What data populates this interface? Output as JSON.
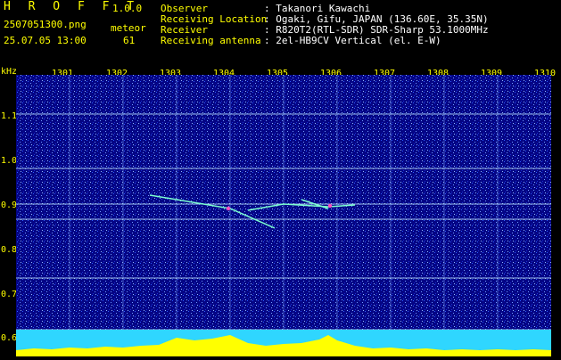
{
  "header": {
    "app_name": "H R O F F T",
    "version": "1.0.0",
    "filename": "2507051300.png",
    "datetime": "25.07.05 13:00",
    "meteor_label": "meteor",
    "meteor_count": "61",
    "fields": [
      {
        "label": "Observer",
        "value": ": Takanori Kawachi"
      },
      {
        "label": "Receiving Location",
        "value": ": Ogaki, Gifu, JAPAN (136.60E, 35.35N)"
      },
      {
        "label": "Receiver",
        "value": ": R820T2(RTL-SDR) SDR-Sharp 53.1000MHz"
      },
      {
        "label": "Receiving antenna",
        "value": ": 2el-HB9CV Vertical (el. E-W)"
      }
    ]
  },
  "axis": {
    "unit_label": "kHz",
    "x_ticks": [
      "1301",
      "1302",
      "1303",
      "1304",
      "1305",
      "1306",
      "1307",
      "1308",
      "1309",
      "1310"
    ],
    "y_ticks": [
      "1.1",
      "1.0",
      "0.9",
      "0.8",
      "0.7",
      "0.6"
    ]
  },
  "colors": {
    "background": "#03037a",
    "text_label": "#ffff00",
    "text_value": "#ffffff",
    "noise_floor": "#2fd6ff",
    "meteor_peaks": "#ffff00"
  }
}
